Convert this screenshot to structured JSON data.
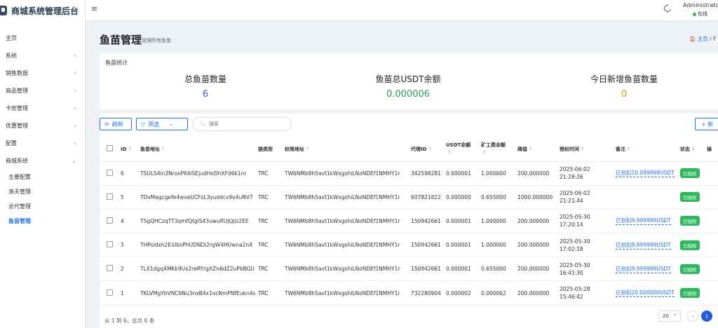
{
  "brand": {
    "title": "商城系统管理后台"
  },
  "topbar": {
    "user": "Administrator",
    "status": "在线"
  },
  "menu": {
    "items": [
      {
        "label": "主页",
        "arrow": ""
      },
      {
        "label": "系统",
        "arrow": "‹"
      },
      {
        "label": "销售数据",
        "arrow": "‹"
      },
      {
        "label": "商品管理",
        "arrow": "‹"
      },
      {
        "label": "卡密管理",
        "arrow": "‹"
      },
      {
        "label": "优惠管理",
        "arrow": "‹"
      },
      {
        "label": "配置",
        "arrow": "‹"
      },
      {
        "label": "商城系统",
        "arrow": "⌄"
      }
    ],
    "sub": [
      "主要配置",
      "渔夫管理",
      "总代管理",
      "鱼苗管理"
    ]
  },
  "page": {
    "title": "鱼苗管理",
    "subtitle": "管理所有鱼苗",
    "crumb_home": "主页",
    "crumb_sep": "/ F"
  },
  "stats": {
    "label": "鱼苗统计",
    "items": [
      {
        "title": "总鱼苗数量",
        "value": "6",
        "color": "#3b5bb5"
      },
      {
        "title": "鱼苗总USDT余额",
        "value": "0.000006",
        "color": "#2e9d57"
      },
      {
        "title": "今日新增鱼苗数量",
        "value": "0",
        "color": "#d4a017"
      }
    ]
  },
  "toolbar": {
    "refresh": "刷新",
    "filter": "筛选",
    "search_placeholder": "搜索",
    "new": "+ 新"
  },
  "table": {
    "headers": [
      "ID",
      "鱼苗地址",
      "链类型",
      "权限地址",
      "代理ID",
      "USDT余额",
      "矿工费余额",
      "阈值",
      "授权时间",
      "备注",
      "状态",
      "操"
    ],
    "rows": [
      {
        "id": "6",
        "addr": "TSULS4in3NroxP64iSEjudHoDhXFd6k1nr",
        "chain": "TRC",
        "perm": "TW6NMb8h5avt1kWxgshiLNoNDEf1NMHY1r",
        "agent": "342598281",
        "usdt": "0.000001",
        "fee": "1.000000",
        "th": "200.000000",
        "date": "2025-06-02",
        "time": "21:28:26",
        "note": "已划扣10.099999USDT",
        "status": "已授权"
      },
      {
        "id": "5",
        "addr": "TDvMagcgefe4wveUCFsL3yuddcv9v4uNV7",
        "chain": "TRC",
        "perm": "TW6NMb8h5avt1kWxgshiLNoNDEf1NMHY1r",
        "agent": "607821822",
        "usdt": "0.000000",
        "fee": "0.655000",
        "th": "1000.000000",
        "date": "2025-06-02",
        "time": "21:21:44",
        "note": "",
        "status": "已授权"
      },
      {
        "id": "4",
        "addr": "TSgQHCzqTT3qmfQtgiS43uwuRUjQjiz2EE",
        "chain": "TRC",
        "perm": "TW6NMb8h5avt1kWxgshiLNoNDEf1NMHY1r",
        "agent": "150942661",
        "usdt": "0.000001",
        "fee": "1.000000",
        "th": "200.000000",
        "date": "2025-05-30",
        "time": "17:20:14",
        "note": "已划扣9.999999USDT",
        "status": "已授权"
      },
      {
        "id": "3",
        "addr": "THPsidxh2EiUbsPhUDNDi2rgW4HUwna2nX",
        "chain": "TRC",
        "perm": "TW6NMb8h5avt1kWxgshiLNoNDEf1NMHY1r",
        "agent": "150942661",
        "usdt": "0.000001",
        "fee": "1.000000",
        "th": "200.000000",
        "date": "2025-05-30",
        "time": "17:02:18",
        "note": "已划扣9.999999USDT",
        "status": "已授权"
      },
      {
        "id": "2",
        "addr": "TLX1dgqXMKk9Ux2reRYrgXZnAdZ2uPbBGU",
        "chain": "TRC",
        "perm": "TW6NMb8h5avt1kWxgshiLNoNDEf1NMHY1r",
        "agent": "150942661",
        "usdt": "0.000001",
        "fee": "0.655000",
        "th": "200.000000",
        "date": "2025-05-30",
        "time": "16:41:30",
        "note": "已划扣9.999999USDT",
        "status": "已授权"
      },
      {
        "id": "1",
        "addr": "TKLVMgYbVNC6Nu3nxB4x1ocNmPNfEukn4s",
        "chain": "TRC",
        "perm": "TW6NMb8h5avt1kWxgshiLNoNDEf1NMHY1r",
        "agent": "732280904",
        "usdt": "0.000002",
        "fee": "0.000062",
        "th": "200.000000",
        "date": "2025-05-28",
        "time": "15:46:42",
        "note": "已划扣20.000000USDT",
        "status": "已授权"
      }
    ]
  },
  "footer": {
    "summary": "从 1 到 6，总共 6 条",
    "page_size": "20",
    "current_page": "1"
  }
}
